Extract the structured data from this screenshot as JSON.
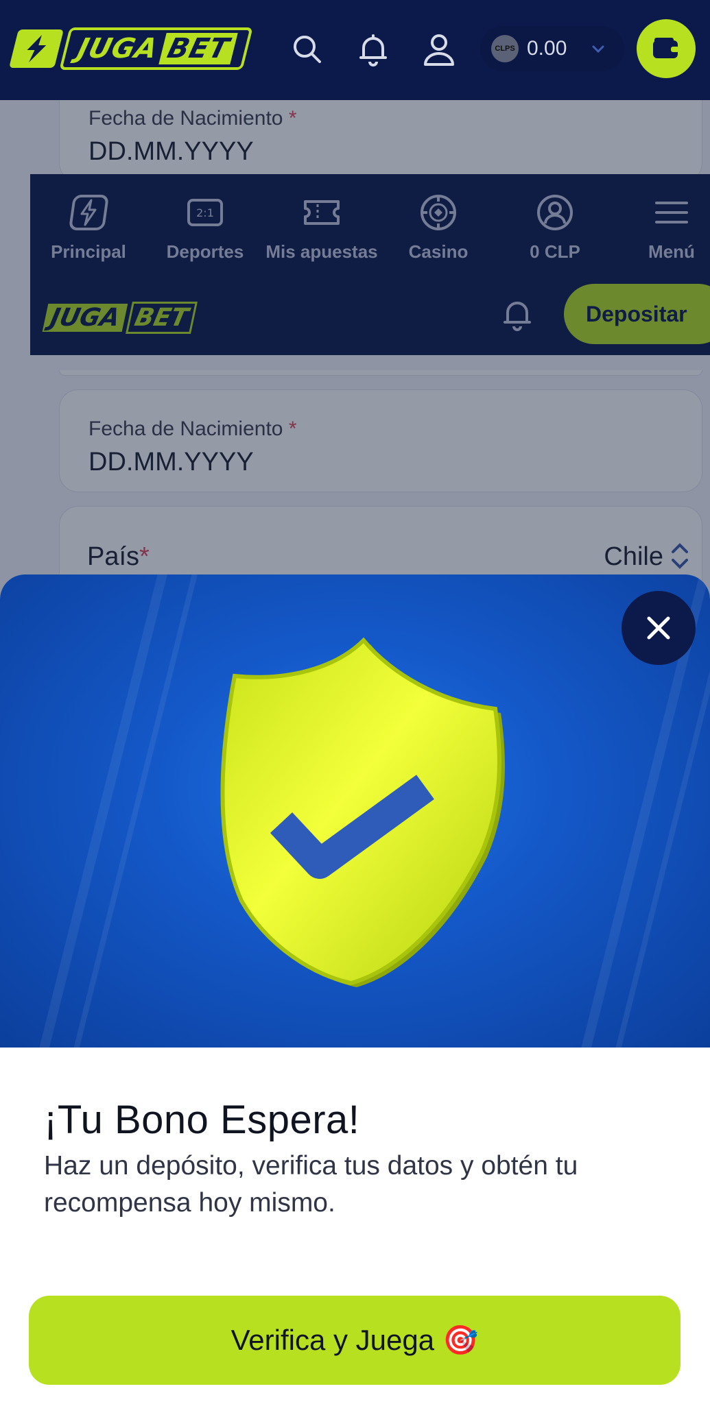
{
  "header": {
    "logo_left": "JUGA",
    "logo_right": "BET",
    "currency_badge": "CLPS",
    "balance": "0.00"
  },
  "form": {
    "birthdate_label_top": "Fecha de Nacimiento",
    "birthdate_value_top": "DD.MM.YYYY",
    "birthdate_label": "Fecha de Nacimiento",
    "birthdate_value": "DD.MM.YYYY",
    "required_mark": "*",
    "country_label": "País",
    "country_value": "Chile"
  },
  "nav": {
    "items": [
      {
        "label": "Principal",
        "icon": "lightning-icon"
      },
      {
        "label": "Deportes",
        "icon": "scoreboard-icon"
      },
      {
        "label": "Mis apuestas",
        "icon": "ticket-icon"
      },
      {
        "label": "Casino",
        "icon": "chip-icon"
      },
      {
        "label": "0 CLP",
        "icon": "user-circle-icon"
      },
      {
        "label": "Menú",
        "icon": "hamburger-icon"
      }
    ],
    "scoreboard_text": "2:1",
    "logo_left": "JUGA",
    "logo_right": "BET",
    "deposit_label": "Depositar"
  },
  "modal": {
    "title": "¡Tu Bono Espera!",
    "description": "Haz un depósito, verifica tus datos y obtén tu recompensa hoy mismo.",
    "cta_label": "Verifica y Juega",
    "cta_emoji": "🎯"
  },
  "colors": {
    "navy": "#0c1a4b",
    "lime": "#b7e021",
    "hero_blue": "#1458c8"
  }
}
